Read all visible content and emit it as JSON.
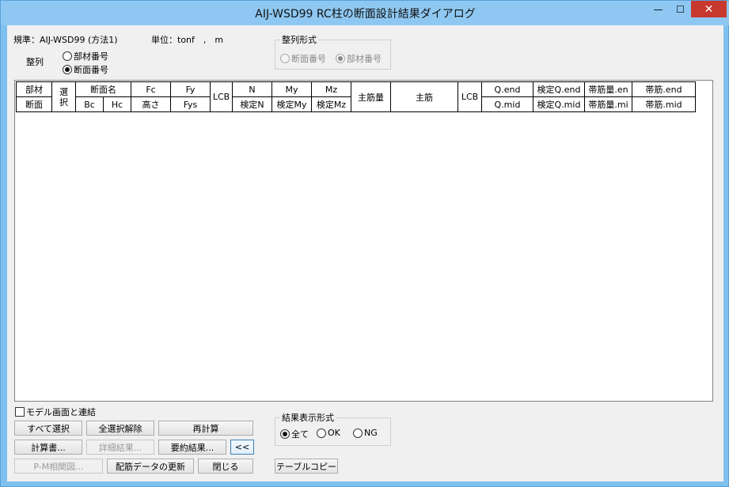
{
  "window": {
    "title": "AIJ-WSD99 RC柱の断面設計結果ダイアログ",
    "min_glyph": "—",
    "max_glyph": "☐",
    "close_glyph": "✕"
  },
  "info": {
    "standard": "規準：AIJ-WSD99 (方法1)",
    "unit": "単位：tonf　,　m"
  },
  "sort": {
    "label": "整列",
    "options": [
      {
        "label": "部材番号",
        "selected": false
      },
      {
        "label": "断面番号",
        "selected": true
      }
    ]
  },
  "sort_format": {
    "title": "整列形式",
    "options": [
      {
        "label": "断面番号",
        "selected": false
      },
      {
        "label": "部材番号",
        "selected": true
      }
    ]
  },
  "table": {
    "header_top": [
      "部材",
      "選択",
      "断面名",
      "Fc",
      "Fy",
      "LCB",
      "N",
      "My",
      "Mz",
      "主筋量",
      "主筋",
      "LCB",
      "Q.end",
      "検定Q.end",
      "帯筋量.en",
      "帯筋.end"
    ],
    "header_bottom": [
      "断面",
      "Bc",
      "Hc",
      "高さ",
      "Fys",
      "検定N",
      "検定My",
      "検定Mz",
      "Q.mid",
      "検定Q.mid",
      "帯筋量.mi",
      "帯筋.mid"
    ],
    "rows": []
  },
  "model_link": {
    "label": "モデル画面と連結",
    "checked": false
  },
  "buttons": {
    "select_all": "すべて選択",
    "deselect_all": "全選択解除",
    "recalc": "再計算",
    "report": "計算書...",
    "detail": "詳細結果...",
    "summary": "要約結果...",
    "collapse": "<<",
    "pm_chart": "P-M相関図...",
    "update_rebar": "配筋データの更新",
    "close": "閉じる",
    "copy_table": "テーブルコピー"
  },
  "result_format": {
    "title": "結果表示形式",
    "options": [
      {
        "label": "全て",
        "selected": true
      },
      {
        "label": "OK",
        "selected": false
      },
      {
        "label": "NG",
        "selected": false
      }
    ]
  }
}
